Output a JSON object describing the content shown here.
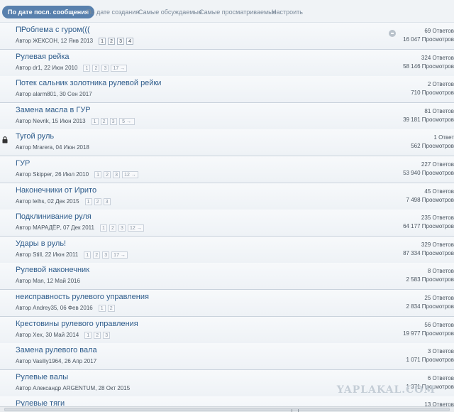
{
  "tabs": [
    {
      "label": "По дате посл. сообщения",
      "active": true
    },
    {
      "label": "По дате создания"
    },
    {
      "label": "Самые обсуждаемые"
    },
    {
      "label": "Самые просматриваемые"
    },
    {
      "label": "Настроить"
    }
  ],
  "topics": [
    {
      "title": "ПРоблема с гуром(((",
      "author": "Автор ЖЕКСОН",
      "date": ", 12 Янв 2013",
      "pages": [
        "1",
        "2",
        "3",
        "4"
      ],
      "replies": "69 Ответов",
      "views": "16 047 Просмотров",
      "icon": "unread-dot-icon"
    },
    {
      "title": "Рулевая рейка",
      "author": "Автор dr1",
      "date": ", 22 Июн 2010",
      "pages": [
        "1",
        "2",
        "3",
        "17 →"
      ],
      "replies": "324 Ответов",
      "views": "58 146 Просмотров"
    },
    {
      "title": "Потек сальник золотника рулевой рейки",
      "author": "Автор alarm801",
      "date": ", 30 Сен 2017",
      "pages": [],
      "replies": "2 Ответов",
      "views": "710 Просмотров"
    },
    {
      "title": "Замена масла в ГУР",
      "author": "Автор Nevrik",
      "date": ", 15 Июн 2013",
      "pages": [
        "1",
        "2",
        "3",
        "5 →"
      ],
      "replies": "81 Ответов",
      "views": "39 181 Просмотров"
    },
    {
      "title": "Тугой руль",
      "author": "Автор Mrarera",
      "date": ", 04 Июн 2018",
      "pages": [],
      "replies": "1 Ответ",
      "views": "562 Просмотров",
      "icon": "lock-icon"
    },
    {
      "title": "ГУР",
      "author": "Автор Skipper",
      "date": ", 26 Июл 2010",
      "pages": [
        "1",
        "2",
        "3",
        "12 →"
      ],
      "replies": "227 Ответов",
      "views": "53 940 Просмотров"
    },
    {
      "title": "Наконечники от Ирито",
      "author": "Автор leihs",
      "date": ", 02 Дек 2015",
      "pages": [
        "1",
        "2",
        "3"
      ],
      "replies": "45 Ответов",
      "views": "7 498 Просмотров"
    },
    {
      "title": "Подклинивание руля",
      "author": "Автор МАРАДЁР",
      "date": ", 07 Дек 2011",
      "pages": [
        "1",
        "2",
        "3",
        "12 →"
      ],
      "replies": "235 Ответов",
      "views": "64 177 Просмотров"
    },
    {
      "title": "Удары в руль!",
      "author": "Автор Still",
      "date": ", 22 Июн 2011",
      "pages": [
        "1",
        "2",
        "3",
        "17 →"
      ],
      "replies": "329 Ответов",
      "views": "87 334 Просмотров"
    },
    {
      "title": "Рулевой наконечник",
      "author": "Автор Man",
      "date": ", 12 Май 2016",
      "pages": [],
      "replies": "8 Ответов",
      "views": "2 583 Просмотров"
    },
    {
      "title": "неисправность рулевого управления",
      "author": "Автор Andrey35",
      "date": ", 06 Фев 2016",
      "pages": [
        "1",
        "2"
      ],
      "replies": "25 Ответов",
      "views": "2 834 Просмотров"
    },
    {
      "title": "Крестовины рулевого управления",
      "author": "Автор Xex",
      "date": ", 30 Май 2014",
      "pages": [
        "1",
        "2",
        "3"
      ],
      "replies": "56 Ответов",
      "views": "19 977 Просмотров"
    },
    {
      "title": "Замена рулевого вала",
      "author": "Автор Vasiliy1964",
      "date": ", 26 Апр 2017",
      "pages": [],
      "replies": "3 Ответов",
      "views": "1 071 Просмотров"
    },
    {
      "title": "Рулевые валы",
      "author": "Автор Александр ARGENTUM",
      "date": ", 28 Окт 2015",
      "pages": [],
      "replies": "6 Ответов",
      "views": "1 371 Просмотров"
    },
    {
      "title": "Рулевые тяги",
      "author": "",
      "date": "",
      "pages": [],
      "replies": "13 Ответов",
      "views": ""
    }
  ],
  "watermark": "YAPLAKAL.COM"
}
